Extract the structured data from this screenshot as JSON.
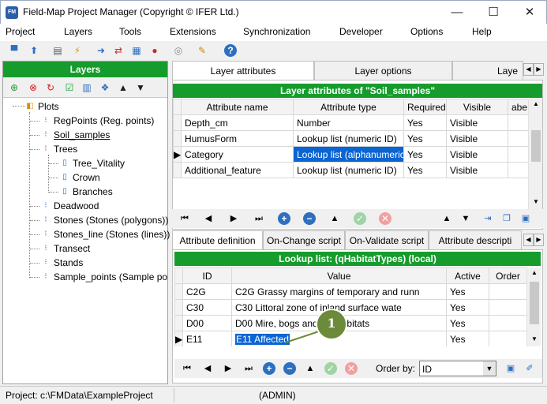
{
  "window": {
    "app_icon": "FM",
    "title": "Field-Map Project Manager (Copyright © IFER Ltd.)",
    "minimize": "—",
    "maximize": "☐",
    "close": "✕"
  },
  "menu": [
    "Project",
    "Layers",
    "Tools",
    "Extensions",
    "Synchronization",
    "Developer",
    "Options",
    "Help"
  ],
  "layers_panel": {
    "header": "Layers",
    "tree": [
      {
        "label": "Plots"
      },
      {
        "label": "RegPoints (Reg. points)"
      },
      {
        "label": "Soil_samples"
      },
      {
        "label": "Trees"
      },
      {
        "label": "Tree_Vitality"
      },
      {
        "label": "Crown"
      },
      {
        "label": "Branches"
      },
      {
        "label": "Deadwood"
      },
      {
        "label": "Stones (Stones (polygons))"
      },
      {
        "label": "Stones_line (Stones (lines))"
      },
      {
        "label": "Transect"
      },
      {
        "label": "Stands"
      },
      {
        "label": "Sample_points (Sample po"
      }
    ]
  },
  "tabs_top": [
    "Layer attributes",
    "Layer options",
    "Laye"
  ],
  "attributes": {
    "header": "Layer attributes of \"Soil_samples\"",
    "columns": [
      "Attribute name",
      "Attribute type",
      "Required",
      "Visible",
      "abe"
    ],
    "rows": [
      [
        "Depth_cm",
        "Number",
        "Yes",
        "Visible"
      ],
      [
        "HumusForm",
        "Lookup list (numeric ID)",
        "Yes",
        "Visible"
      ],
      [
        "Category",
        "Lookup list (alphanumeric",
        "Yes",
        "Visible"
      ],
      [
        "Additional_feature",
        "Lookup list (numeric ID)",
        "Yes",
        "Visible"
      ]
    ]
  },
  "tabs_bottom": [
    "Attribute definition",
    "On-Change script",
    "On-Validate script",
    "Attribute descripti"
  ],
  "lookup": {
    "header": "Lookup list: (qHabitatTypes) (local)",
    "columns": [
      "ID",
      "Value",
      "Active",
      "Order"
    ],
    "rows": [
      [
        "C2G",
        "C2G Grassy margins of temporary and runn",
        "Yes",
        ""
      ],
      [
        "C30",
        "C30 Littoral zone of inland surface wate",
        "Yes",
        ""
      ],
      [
        "D00",
        "D00 Mire, bogs and fen habitats",
        "Yes",
        ""
      ],
      [
        "E11",
        "E11 Affected",
        "Yes",
        ""
      ]
    ]
  },
  "order_by": {
    "label": "Order by:",
    "value": "ID"
  },
  "callout": "1",
  "status": {
    "project": "Project: c:\\FMData\\ExampleProject",
    "user": "(ADMIN)"
  },
  "colors": {
    "green_header": "#169c2c",
    "selection": "#0a64d2",
    "callout": "#6b8a3a"
  }
}
